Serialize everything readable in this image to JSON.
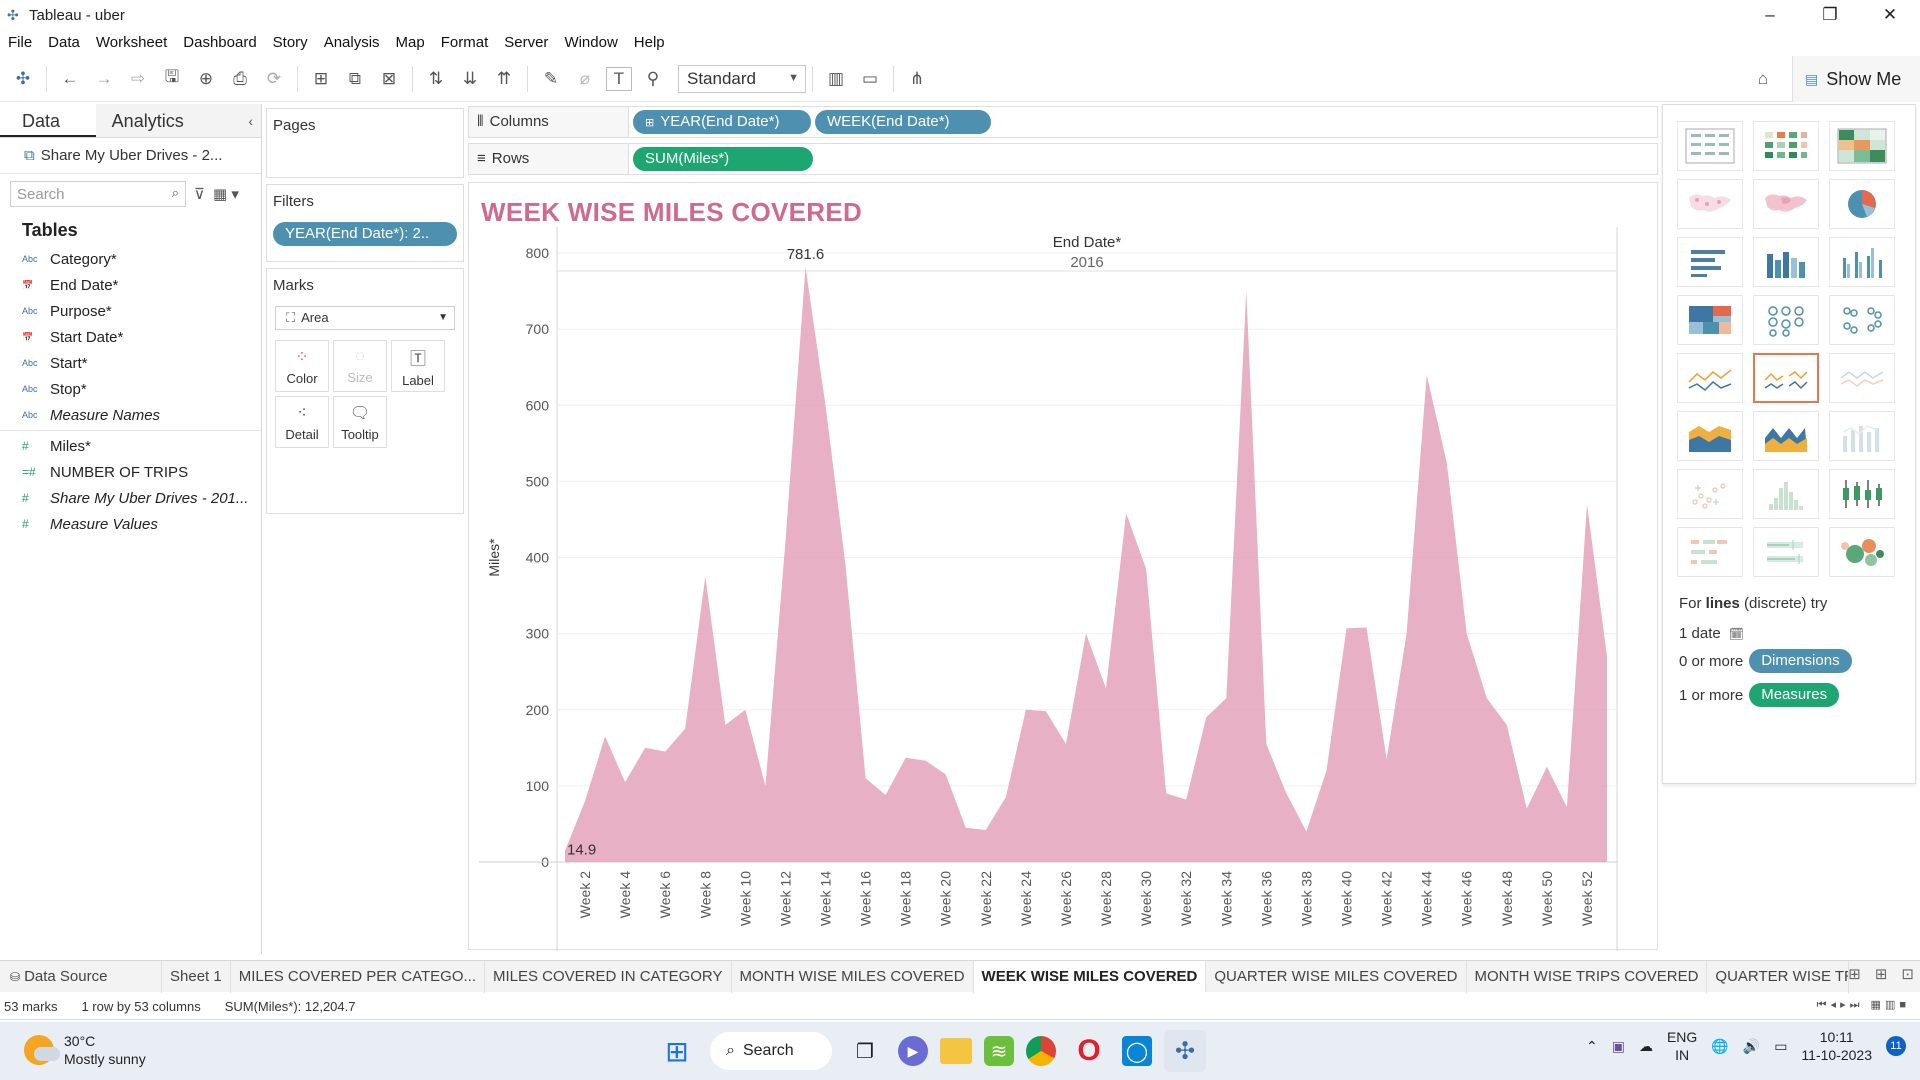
{
  "window": {
    "title": "Tableau - uber",
    "minimize": "–",
    "restore": "❐",
    "close": "✕"
  },
  "menu": [
    "File",
    "Data",
    "Worksheet",
    "Dashboard",
    "Story",
    "Analysis",
    "Map",
    "Format",
    "Server",
    "Window",
    "Help"
  ],
  "toolbar": {
    "fit_mode": "Standard",
    "show_me": "Show Me"
  },
  "data_pane": {
    "tab_data": "Data",
    "tab_analytics": "Analytics",
    "datasource": "Share My Uber Drives - 2...",
    "search_placeholder": "Search",
    "tables_heading": "Tables",
    "dimensions": [
      {
        "type": "Abc",
        "name": "Category*"
      },
      {
        "type": "date",
        "name": "End Date*"
      },
      {
        "type": "Abc",
        "name": "Purpose*"
      },
      {
        "type": "date",
        "name": "Start Date*"
      },
      {
        "type": "Abc",
        "name": "Start*"
      },
      {
        "type": "Abc",
        "name": "Stop*"
      },
      {
        "type": "Abc",
        "name": "Measure Names"
      }
    ],
    "measures": [
      {
        "type": "#",
        "name": "Miles*"
      },
      {
        "type": "=#",
        "name": "NUMBER OF TRIPS"
      },
      {
        "type": "#",
        "name": "Share My Uber Drives - 201..."
      },
      {
        "type": "#",
        "name": "Measure Values"
      }
    ]
  },
  "cards": {
    "pages": "Pages",
    "filters": "Filters",
    "filter_pill": "YEAR(End Date*): 2..",
    "marks": "Marks",
    "mark_type": "Area",
    "mark_buttons": [
      "Color",
      "Size",
      "Label",
      "Detail",
      "Tooltip"
    ]
  },
  "shelves": {
    "columns_label": "Columns",
    "rows_label": "Rows",
    "columns_pills": [
      "YEAR(End Date*)",
      "WEEK(End Date*)"
    ],
    "rows_pills": [
      "SUM(Miles*)"
    ]
  },
  "viz": {
    "title": "WEEK WISE MILES COVERED",
    "header_field": "End Date*",
    "header_year": "2016"
  },
  "chart_data": {
    "type": "area",
    "title": "WEEK WISE MILES COVERED",
    "xlabel": "",
    "ylabel": "Miles*",
    "ylim": [
      0,
      800
    ],
    "yticks": [
      0,
      100,
      200,
      300,
      400,
      500,
      600,
      700,
      800
    ],
    "x": [
      "Week 1",
      "Week 2",
      "Week 3",
      "Week 4",
      "Week 5",
      "Week 6",
      "Week 7",
      "Week 8",
      "Week 9",
      "Week 10",
      "Week 11",
      "Week 12",
      "Week 13",
      "Week 14",
      "Week 15",
      "Week 16",
      "Week 17",
      "Week 18",
      "Week 19",
      "Week 20",
      "Week 21",
      "Week 22",
      "Week 23",
      "Week 24",
      "Week 25",
      "Week 26",
      "Week 27",
      "Week 28",
      "Week 29",
      "Week 30",
      "Week 31",
      "Week 32",
      "Week 33",
      "Week 34",
      "Week 35",
      "Week 36",
      "Week 37",
      "Week 38",
      "Week 39",
      "Week 40",
      "Week 41",
      "Week 42",
      "Week 43",
      "Week 44",
      "Week 45",
      "Week 46",
      "Week 47",
      "Week 48",
      "Week 49",
      "Week 50",
      "Week 51",
      "Week 52",
      "Week 53"
    ],
    "x_tick_labels": [
      "Week 2",
      "Week 4",
      "Week 6",
      "Week 8",
      "Week 10",
      "Week 12",
      "Week 14",
      "Week 16",
      "Week 18",
      "Week 20",
      "Week 22",
      "Week 24",
      "Week 26",
      "Week 28",
      "Week 30",
      "Week 32",
      "Week 34",
      "Week 36",
      "Week 38",
      "Week 40",
      "Week 42",
      "Week 44",
      "Week 46",
      "Week 48",
      "Week 50",
      "Week 52"
    ],
    "values": [
      14.9,
      80,
      165,
      105,
      150,
      145,
      175,
      375,
      180,
      200,
      100,
      420,
      781.6,
      600,
      390,
      110,
      88,
      137,
      133,
      115,
      45,
      42,
      85,
      200,
      198,
      155,
      300,
      228,
      458,
      385,
      90,
      82,
      190,
      215,
      750,
      155,
      90,
      40,
      120,
      307,
      308,
      135,
      300,
      640,
      525,
      300,
      215,
      180,
      70,
      125,
      72,
      470,
      270
    ],
    "data_labels": [
      {
        "week": "Week 1",
        "text": "14.9"
      },
      {
        "week": "Week 13",
        "text": "781.6"
      }
    ],
    "color": "#e3a2ba",
    "grid": true
  },
  "show_me": {
    "hint_prefix": "For ",
    "hint_bold": "lines",
    "hint_suffix": " (discrete) try",
    "req_date": "1 date",
    "req_dimensions_prefix": "0 or more",
    "req_dimensions_pill": "Dimensions",
    "req_measures_prefix": "1 or more",
    "req_measures_pill": "Measures"
  },
  "sheet_tabs": {
    "data_source": "Data Source",
    "sheets": [
      "Sheet 1",
      "MILES COVERED PER CATEGO...",
      "MILES COVERED IN CATEGORY",
      "MONTH WISE MILES COVERED",
      "WEEK WISE MILES COVERED",
      "QUARTER WISE MILES COVERED",
      "MONTH WISE TRIPS COVERED",
      "QUARTER WISE TRI"
    ],
    "active": "WEEK WISE MILES COVERED"
  },
  "status": {
    "marks": "53 marks",
    "rows_cols": "1 row by 53 columns",
    "sum": "SUM(Miles*): 12,204.7"
  },
  "taskbar": {
    "temperature": "30°C",
    "weather": "Mostly sunny",
    "search": "Search",
    "lang1": "ENG",
    "lang2": "IN",
    "time": "10:11",
    "date": "11-10-2023",
    "notifications": "11"
  },
  "colors": {
    "accent_blue": "#4e90b0",
    "accent_green": "#1ea672",
    "title_pink": "#d0698f",
    "area_pink": "#e3a2ba"
  }
}
